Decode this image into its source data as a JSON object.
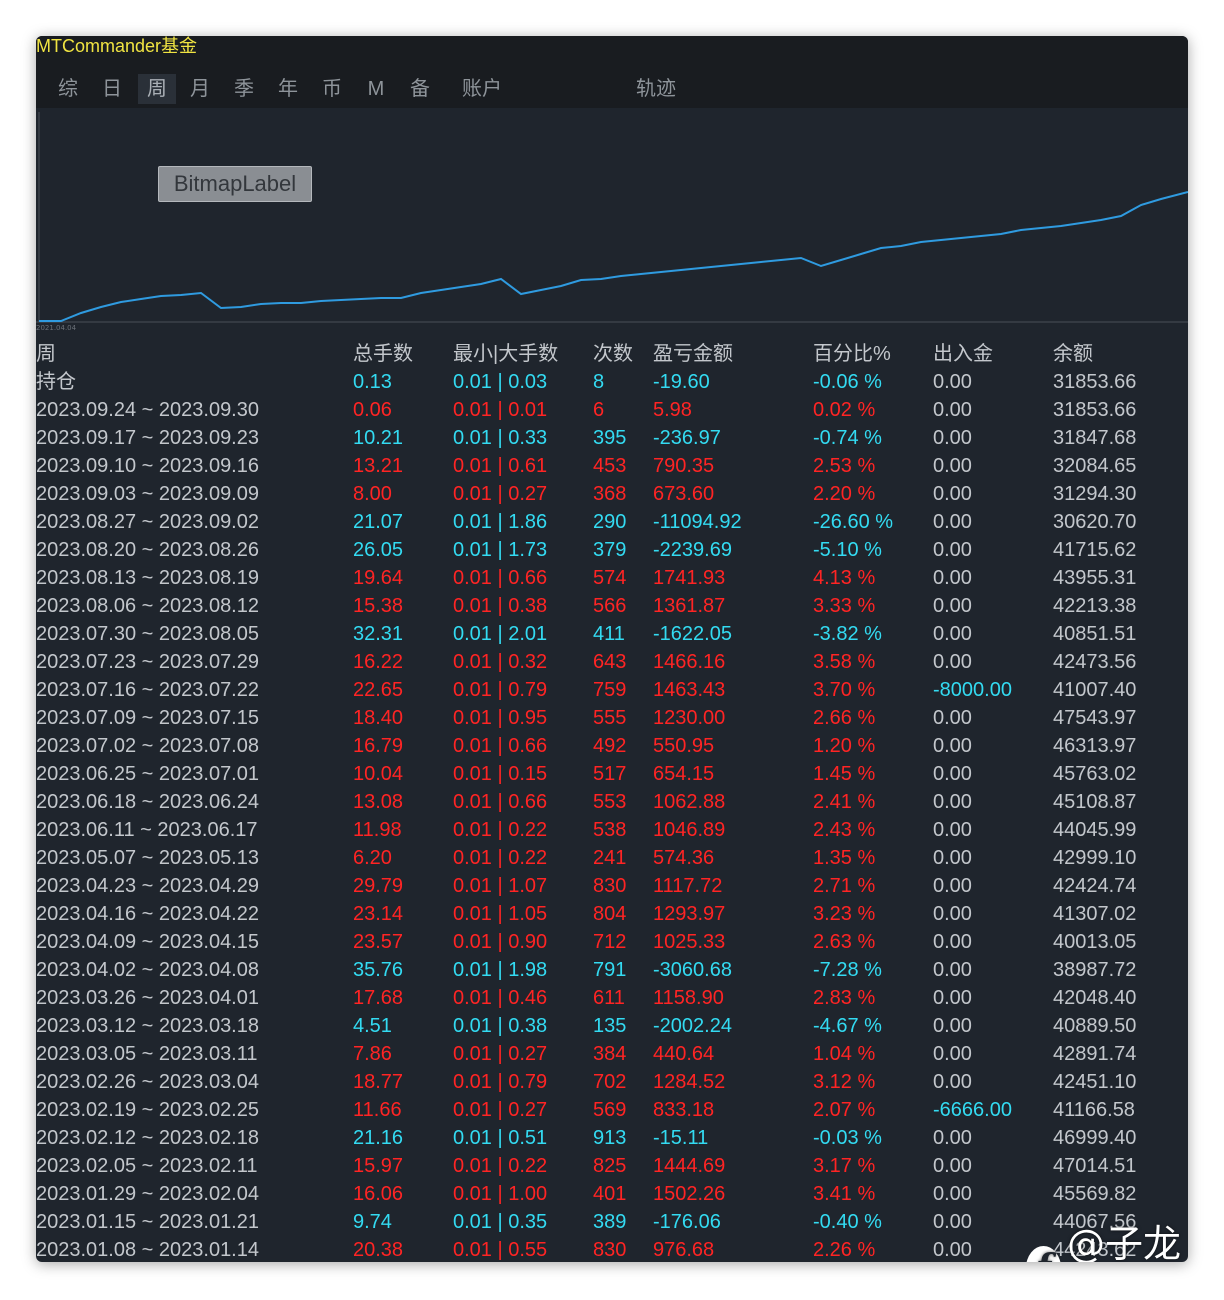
{
  "window": {
    "title": "MTCommander基金"
  },
  "tabs": [
    {
      "label": "综"
    },
    {
      "label": "日"
    },
    {
      "label": "周",
      "active": true
    },
    {
      "label": "月"
    },
    {
      "label": "季"
    },
    {
      "label": "年"
    },
    {
      "label": "币"
    },
    {
      "label": "M"
    },
    {
      "label": "备"
    },
    {
      "label": "账户"
    },
    {
      "label": "轨迹"
    }
  ],
  "chart": {
    "bitmap_label": "BitmapLabel",
    "x_start_label": "2021.04.04",
    "line_color": "#2f9be0"
  },
  "table": {
    "headers": {
      "period": "周",
      "lots": "总手数",
      "minmax": "最小|大手数",
      "count": "次数",
      "pnl": "盈亏金额",
      "percent": "百分比%",
      "deposit": "出入金",
      "balance": "余额"
    },
    "rows": [
      {
        "period": "持仓",
        "lots": "0.13",
        "minmax": "0.01 | 0.03",
        "count": "8",
        "pnl": "-19.60",
        "percent": "-0.06 %",
        "deposit": "0.00",
        "balance": "31853.66"
      },
      {
        "period": "2023.09.24 ~ 2023.09.30",
        "lots": "0.06",
        "minmax": "0.01 | 0.01",
        "count": "6",
        "pnl": "5.98",
        "percent": "0.02 %",
        "deposit": "0.00",
        "balance": "31853.66"
      },
      {
        "period": "2023.09.17 ~ 2023.09.23",
        "lots": "10.21",
        "minmax": "0.01 | 0.33",
        "count": "395",
        "pnl": "-236.97",
        "percent": "-0.74 %",
        "deposit": "0.00",
        "balance": "31847.68"
      },
      {
        "period": "2023.09.10 ~ 2023.09.16",
        "lots": "13.21",
        "minmax": "0.01 | 0.61",
        "count": "453",
        "pnl": "790.35",
        "percent": "2.53 %",
        "deposit": "0.00",
        "balance": "32084.65"
      },
      {
        "period": "2023.09.03 ~ 2023.09.09",
        "lots": "8.00",
        "minmax": "0.01 | 0.27",
        "count": "368",
        "pnl": "673.60",
        "percent": "2.20 %",
        "deposit": "0.00",
        "balance": "31294.30"
      },
      {
        "period": "2023.08.27 ~ 2023.09.02",
        "lots": "21.07",
        "minmax": "0.01 | 1.86",
        "count": "290",
        "pnl": "-11094.92",
        "percent": "-26.60 %",
        "deposit": "0.00",
        "balance": "30620.70"
      },
      {
        "period": "2023.08.20 ~ 2023.08.26",
        "lots": "26.05",
        "minmax": "0.01 | 1.73",
        "count": "379",
        "pnl": "-2239.69",
        "percent": "-5.10 %",
        "deposit": "0.00",
        "balance": "41715.62"
      },
      {
        "period": "2023.08.13 ~ 2023.08.19",
        "lots": "19.64",
        "minmax": "0.01 | 0.66",
        "count": "574",
        "pnl": "1741.93",
        "percent": "4.13 %",
        "deposit": "0.00",
        "balance": "43955.31"
      },
      {
        "period": "2023.08.06 ~ 2023.08.12",
        "lots": "15.38",
        "minmax": "0.01 | 0.38",
        "count": "566",
        "pnl": "1361.87",
        "percent": "3.33 %",
        "deposit": "0.00",
        "balance": "42213.38"
      },
      {
        "period": "2023.07.30 ~ 2023.08.05",
        "lots": "32.31",
        "minmax": "0.01 | 2.01",
        "count": "411",
        "pnl": "-1622.05",
        "percent": "-3.82 %",
        "deposit": "0.00",
        "balance": "40851.51"
      },
      {
        "period": "2023.07.23 ~ 2023.07.29",
        "lots": "16.22",
        "minmax": "0.01 | 0.32",
        "count": "643",
        "pnl": "1466.16",
        "percent": "3.58 %",
        "deposit": "0.00",
        "balance": "42473.56"
      },
      {
        "period": "2023.07.16 ~ 2023.07.22",
        "lots": "22.65",
        "minmax": "0.01 | 0.79",
        "count": "759",
        "pnl": "1463.43",
        "percent": "3.70 %",
        "deposit": "-8000.00",
        "balance": "41007.40"
      },
      {
        "period": "2023.07.09 ~ 2023.07.15",
        "lots": "18.40",
        "minmax": "0.01 | 0.95",
        "count": "555",
        "pnl": "1230.00",
        "percent": "2.66 %",
        "deposit": "0.00",
        "balance": "47543.97"
      },
      {
        "period": "2023.07.02 ~ 2023.07.08",
        "lots": "16.79",
        "minmax": "0.01 | 0.66",
        "count": "492",
        "pnl": "550.95",
        "percent": "1.20 %",
        "deposit": "0.00",
        "balance": "46313.97"
      },
      {
        "period": "2023.06.25 ~ 2023.07.01",
        "lots": "10.04",
        "minmax": "0.01 | 0.15",
        "count": "517",
        "pnl": "654.15",
        "percent": "1.45 %",
        "deposit": "0.00",
        "balance": "45763.02"
      },
      {
        "period": "2023.06.18 ~ 2023.06.24",
        "lots": "13.08",
        "minmax": "0.01 | 0.66",
        "count": "553",
        "pnl": "1062.88",
        "percent": "2.41 %",
        "deposit": "0.00",
        "balance": "45108.87"
      },
      {
        "period": "2023.06.11 ~ 2023.06.17",
        "lots": "11.98",
        "minmax": "0.01 | 0.22",
        "count": "538",
        "pnl": "1046.89",
        "percent": "2.43 %",
        "deposit": "0.00",
        "balance": "44045.99"
      },
      {
        "period": "2023.05.07 ~ 2023.05.13",
        "lots": "6.20",
        "minmax": "0.01 | 0.22",
        "count": "241",
        "pnl": "574.36",
        "percent": "1.35 %",
        "deposit": "0.00",
        "balance": "42999.10"
      },
      {
        "period": "2023.04.23 ~ 2023.04.29",
        "lots": "29.79",
        "minmax": "0.01 | 1.07",
        "count": "830",
        "pnl": "1117.72",
        "percent": "2.71 %",
        "deposit": "0.00",
        "balance": "42424.74"
      },
      {
        "period": "2023.04.16 ~ 2023.04.22",
        "lots": "23.14",
        "minmax": "0.01 | 1.05",
        "count": "804",
        "pnl": "1293.97",
        "percent": "3.23 %",
        "deposit": "0.00",
        "balance": "41307.02"
      },
      {
        "period": "2023.04.09 ~ 2023.04.15",
        "lots": "23.57",
        "minmax": "0.01 | 0.90",
        "count": "712",
        "pnl": "1025.33",
        "percent": "2.63 %",
        "deposit": "0.00",
        "balance": "40013.05"
      },
      {
        "period": "2023.04.02 ~ 2023.04.08",
        "lots": "35.76",
        "minmax": "0.01 | 1.98",
        "count": "791",
        "pnl": "-3060.68",
        "percent": "-7.28 %",
        "deposit": "0.00",
        "balance": "38987.72"
      },
      {
        "period": "2023.03.26 ~ 2023.04.01",
        "lots": "17.68",
        "minmax": "0.01 | 0.46",
        "count": "611",
        "pnl": "1158.90",
        "percent": "2.83 %",
        "deposit": "0.00",
        "balance": "42048.40"
      },
      {
        "period": "2023.03.12 ~ 2023.03.18",
        "lots": "4.51",
        "minmax": "0.01 | 0.38",
        "count": "135",
        "pnl": "-2002.24",
        "percent": "-4.67 %",
        "deposit": "0.00",
        "balance": "40889.50"
      },
      {
        "period": "2023.03.05 ~ 2023.03.11",
        "lots": "7.86",
        "minmax": "0.01 | 0.27",
        "count": "384",
        "pnl": "440.64",
        "percent": "1.04 %",
        "deposit": "0.00",
        "balance": "42891.74"
      },
      {
        "period": "2023.02.26 ~ 2023.03.04",
        "lots": "18.77",
        "minmax": "0.01 | 0.79",
        "count": "702",
        "pnl": "1284.52",
        "percent": "3.12 %",
        "deposit": "0.00",
        "balance": "42451.10"
      },
      {
        "period": "2023.02.19 ~ 2023.02.25",
        "lots": "11.66",
        "minmax": "0.01 | 0.27",
        "count": "569",
        "pnl": "833.18",
        "percent": "2.07 %",
        "deposit": "-6666.00",
        "balance": "41166.58"
      },
      {
        "period": "2023.02.12 ~ 2023.02.18",
        "lots": "21.16",
        "minmax": "0.01 | 0.51",
        "count": "913",
        "pnl": "-15.11",
        "percent": "-0.03 %",
        "deposit": "0.00",
        "balance": "46999.40"
      },
      {
        "period": "2023.02.05 ~ 2023.02.11",
        "lots": "15.97",
        "minmax": "0.01 | 0.22",
        "count": "825",
        "pnl": "1444.69",
        "percent": "3.17 %",
        "deposit": "0.00",
        "balance": "47014.51"
      },
      {
        "period": "2023.01.29 ~ 2023.02.04",
        "lots": "16.06",
        "minmax": "0.01 | 1.00",
        "count": "401",
        "pnl": "1502.26",
        "percent": "3.41 %",
        "deposit": "0.00",
        "balance": "45569.82"
      },
      {
        "period": "2023.01.15 ~ 2023.01.21",
        "lots": "9.74",
        "minmax": "0.01 | 0.35",
        "count": "389",
        "pnl": "-176.06",
        "percent": "-0.40 %",
        "deposit": "0.00",
        "balance": "44067.56"
      },
      {
        "period": "2023.01.08 ~ 2023.01.14",
        "lots": "20.38",
        "minmax": "0.01 | 0.55",
        "count": "830",
        "pnl": "976.68",
        "percent": "2.26 %",
        "deposit": "0.00",
        "balance": "44243.62"
      }
    ]
  },
  "colors": {
    "positive": "#ff2424",
    "negative": "#33dbf2",
    "neutral": "#c3c7cc",
    "title": "#f0e442"
  },
  "watermark": {
    "icon": "logo-icon",
    "text": "@子龙说"
  }
}
